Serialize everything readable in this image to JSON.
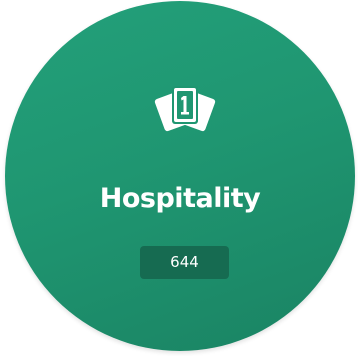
{
  "category_tile": {
    "icon": "playing-cards-icon",
    "title": "Hospitality",
    "count": "644",
    "colors": {
      "background": "#1f9671",
      "badge": "#166b51",
      "text": "#ffffff"
    }
  }
}
